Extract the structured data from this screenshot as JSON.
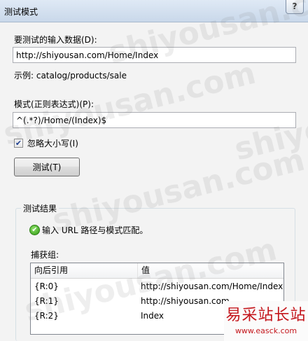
{
  "window": {
    "title": "测试模式",
    "help_label": "?"
  },
  "input": {
    "label": "要测试的输入数据(D):",
    "value": "http://shiyousan.com/Home/Index",
    "example": "示例: catalog/products/sale"
  },
  "pattern": {
    "label": "模式(正则表达式)(P):",
    "value": "^(.*?)/Home/(Index)$"
  },
  "ignore_case": {
    "label": "忽略大小写(I)",
    "checked": true,
    "check_glyph": "✔"
  },
  "test_button": {
    "label": "测试(T)"
  },
  "results": {
    "group_title": "测试结果",
    "status_icon": "check-circle-icon",
    "status_icon_glyph": "✔",
    "status_color": "#2f9a12",
    "match_message": "输入 URL 路径与模式匹配。",
    "captures_label": "捕获组:",
    "columns": [
      "向后引用",
      "值"
    ],
    "rows": [
      {
        "ref": "{R:0}",
        "value": "http://shiyousan.com/Home/Index"
      },
      {
        "ref": "{R:1}",
        "value": "http://shiyousan.com"
      },
      {
        "ref": "{R:2}",
        "value": "Index"
      }
    ]
  },
  "watermarks": [
    "shiyousan.com",
    "shiyousan.com",
    "shiyousan.com",
    "shiyousan.com",
    "shiyousan.com"
  ],
  "brand": {
    "main": "易采站长站",
    "sub": "www.easck.com",
    "color": "#c4161c"
  }
}
